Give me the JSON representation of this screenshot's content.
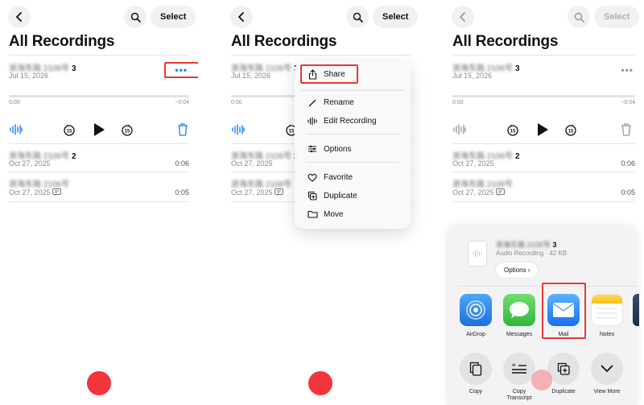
{
  "panel1": {
    "select_label": "Select",
    "title": "All Recordings",
    "recordings": [
      {
        "blurred_name": "浙海东路 2106号",
        "number": "3",
        "date": "Jul 15, 2026",
        "duration": ""
      },
      {
        "blurred_name": "浙海东路 2106号",
        "number": "2",
        "date": "Oct 27, 2025",
        "duration": "0:06"
      },
      {
        "blurred_name": "浙海东路 2106号",
        "number": "",
        "date": "Oct 27, 2025",
        "duration": "0:05"
      }
    ],
    "time_start": "0:00",
    "time_end": "−0:04",
    "more_dots": "•••"
  },
  "panel2": {
    "select_label": "Select",
    "title": "All Recordings",
    "recordings": [
      {
        "blurred_name": "浙海东路 2106号",
        "number": "3",
        "date": "Jul 15, 2026"
      },
      {
        "blurred_name": "浙海东路 2106号",
        "number": "2",
        "date": "Oct 27, 2025"
      },
      {
        "blurred_name": "浙海东路 2106号",
        "number": "",
        "date": "Oct 27, 2025"
      }
    ],
    "time_start": "0:00",
    "menu": {
      "share": "Share",
      "rename": "Rename",
      "edit_recording": "Edit Recording",
      "options": "Options",
      "favorite": "Favorite",
      "duplicate": "Duplicate",
      "move": "Move"
    }
  },
  "panel3": {
    "select_label": "Select",
    "title": "All Recordings",
    "recordings": [
      {
        "blurred_name": "浙海东路 2106号",
        "number": "3",
        "date": "Jul 15, 2026",
        "duration": ""
      },
      {
        "blurred_name": "浙海东路 2106号",
        "number": "2",
        "date": "Oct 27, 2025",
        "duration": "0:06"
      },
      {
        "blurred_name": "浙海东路 2106号",
        "number": "",
        "date": "Oct 27, 2025",
        "duration": "0:05"
      }
    ],
    "time_start": "0:00",
    "time_end": "−0:04",
    "more_dots": "•••",
    "share_sheet": {
      "file_name_blurred": "浙海东路 2106号",
      "file_number": "3",
      "file_subtitle": "Audio Recording · 42 KB",
      "options_label": "Options ›",
      "apps": [
        {
          "label": "AirDrop",
          "icon": "airdrop-icon"
        },
        {
          "label": "Messages",
          "icon": "messages-icon"
        },
        {
          "label": "Mail",
          "icon": "mail-icon"
        },
        {
          "label": "Notes",
          "icon": "notes-icon"
        }
      ],
      "actions": [
        {
          "label": "Copy",
          "icon": "copy-icon"
        },
        {
          "label": "Copy Transcript",
          "icon": "transcript-icon"
        },
        {
          "label": "Duplicate",
          "icon": "duplicate-icon"
        },
        {
          "label": "View More",
          "icon": "chevron-down-icon"
        }
      ]
    }
  },
  "colors": {
    "accent_blue": "#1a82f7",
    "record_red": "#f2353b",
    "highlight_red": "#e53935",
    "muted_gray": "#8a8a8e"
  }
}
